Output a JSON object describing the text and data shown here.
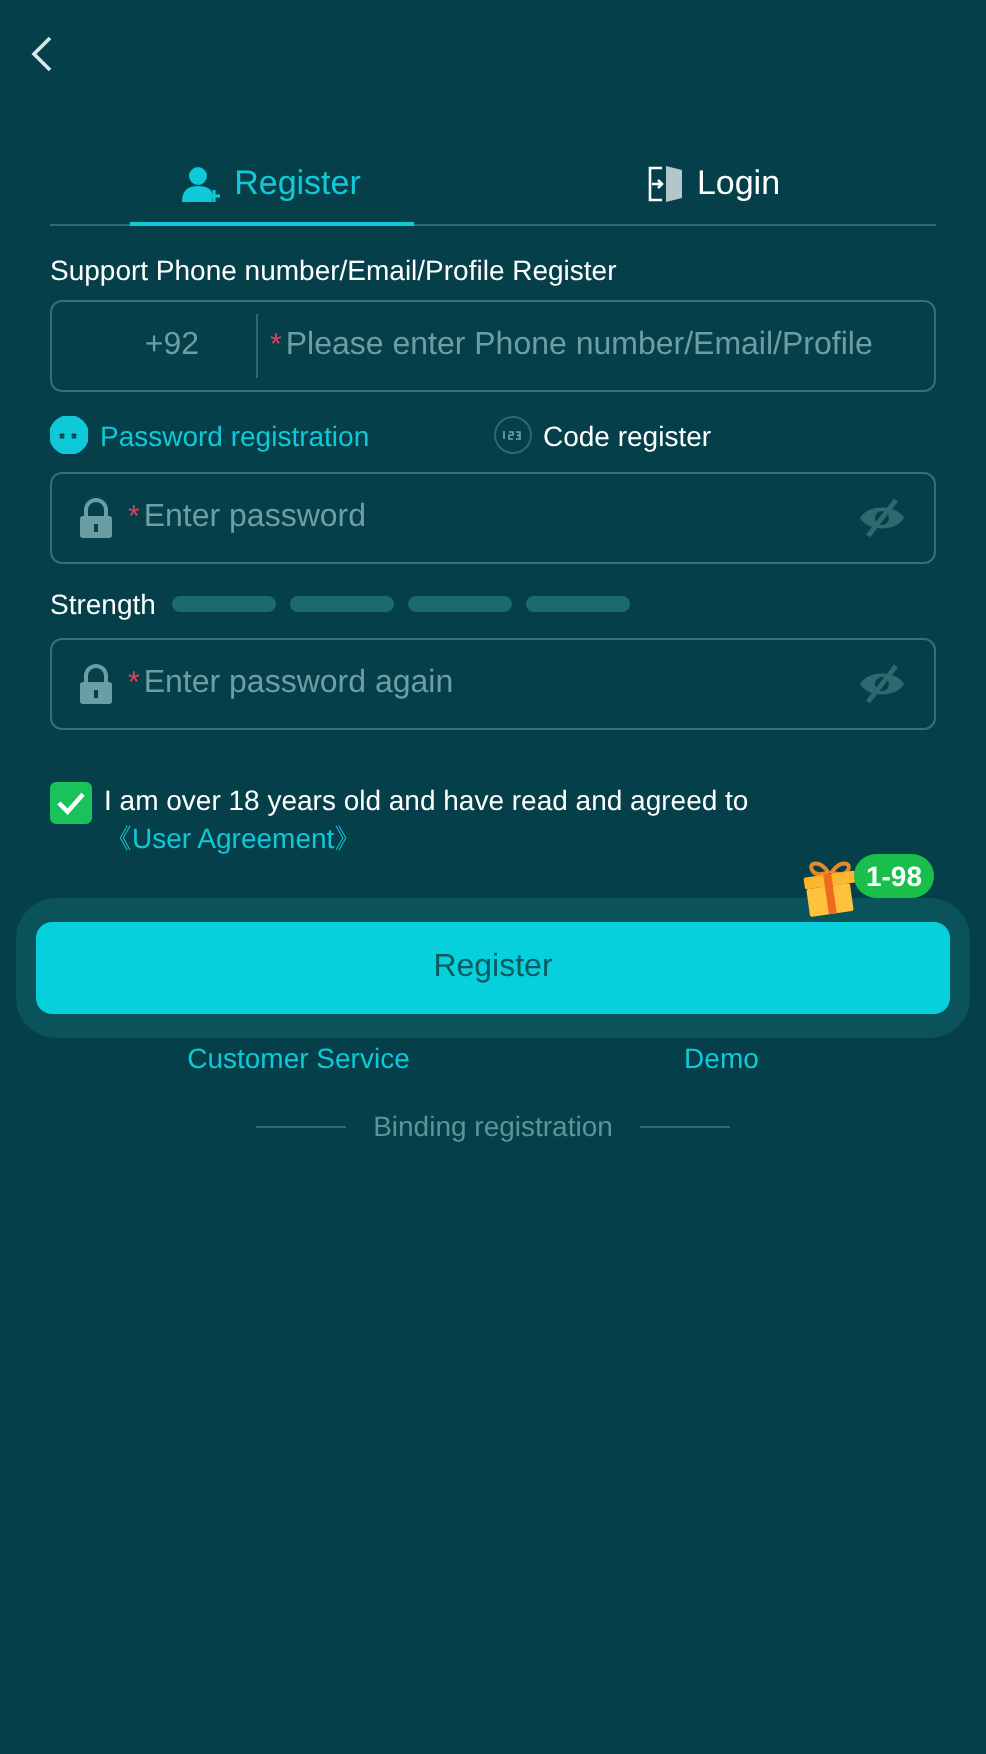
{
  "tabs": [
    {
      "label": "Register",
      "kind": "register",
      "selected": true
    },
    {
      "label": "Login",
      "kind": "login",
      "selected": false
    }
  ],
  "account": {
    "label": "Support Phone number/Email/Profile Register",
    "prefix": "+92",
    "required_mark": "*",
    "placeholder": "Please enter Phone number/Email/Profile"
  },
  "modes": [
    {
      "label": "Password registration",
      "kind": "password",
      "selected": true
    },
    {
      "label": "Code register",
      "kind": "code",
      "selected": false
    }
  ],
  "password": {
    "required_mark": "*",
    "placeholder": "Enter password"
  },
  "strength": {
    "label": "Strength"
  },
  "confirm": {
    "required_mark": "*",
    "placeholder": "Enter password again"
  },
  "agreement": {
    "checked": true,
    "text": "I am over 18 years old and have read and agreed to",
    "link": "《User Agreement》"
  },
  "promo_badge": "1-98",
  "submit": "Register",
  "links": [
    "Customer Service",
    "Demo"
  ],
  "divider_text": "Binding registration"
}
